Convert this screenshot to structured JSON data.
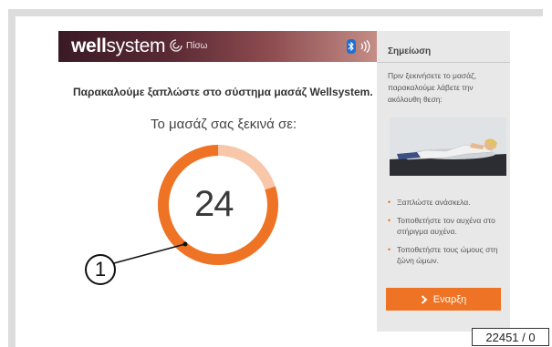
{
  "header": {
    "logo_bold": "well",
    "logo_light": "system",
    "back_label": "Πίσω",
    "icons": [
      "back-arrow-icon",
      "bluetooth-icon",
      "signal-waves-icon"
    ]
  },
  "main": {
    "prompt": "Παρακαλούμε ξαπλώστε στο σύστημα μασάζ Wellsystem.",
    "starts_in_label": "Το μασάζ σας ξεκινά σε:",
    "countdown": "24",
    "progress_fraction_remaining": 0.8
  },
  "sidebar": {
    "title": "Σημείωση",
    "intro": "Πριν ξεκινήσετε το μασάζ, παρακαλούμε λάβετε την ακόλουθη θεση:",
    "steps": [
      "Ξαπλώστε ανάσκελα.",
      "Τοποθετήστε τον αυχένα στο στήριγμα αυχένα.",
      "Τοποθετήστε τους ώμους στη ζώνη ώμων."
    ],
    "start_label": "Εναρξη"
  },
  "annotation": {
    "callout_number": "1",
    "reference": "22451 / 0"
  },
  "colors": {
    "accent": "#ee7324",
    "accent_light": "#f8c6a8",
    "header_dark": "#3a1a26",
    "sidebar_bg": "#e8e8e8"
  }
}
